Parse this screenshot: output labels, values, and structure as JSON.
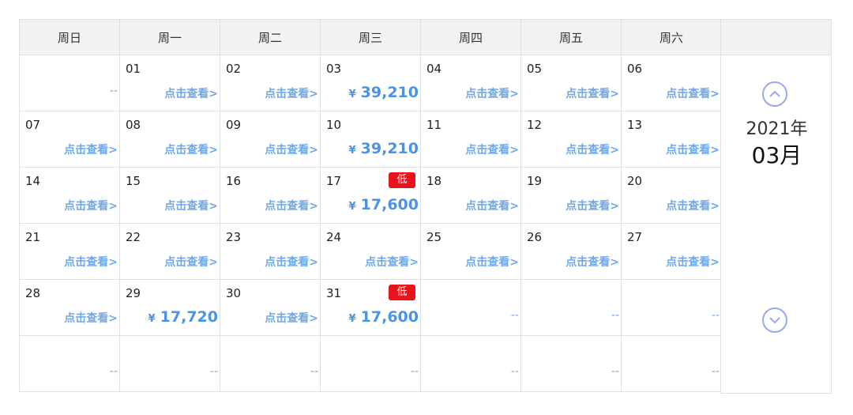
{
  "weekdays": [
    "周日",
    "周一",
    "周二",
    "周三",
    "周四",
    "周五",
    "周六"
  ],
  "view_link": "点击查看>",
  "low_badge": "低",
  "currency": "¥",
  "empty_mark": "--",
  "colors": {
    "accent": "#4a94e8",
    "badge": "#e8131b",
    "arrow": "#9aa6f0"
  },
  "navigator": {
    "year": "2021年",
    "month": "03月",
    "prev_icon": "chevron-up-icon",
    "next_icon": "chevron-down-icon"
  },
  "weeks": [
    [
      {
        "day": "",
        "type": "empty"
      },
      {
        "day": "01",
        "type": "link"
      },
      {
        "day": "02",
        "type": "link"
      },
      {
        "day": "03",
        "type": "price",
        "price": "39,210"
      },
      {
        "day": "04",
        "type": "link"
      },
      {
        "day": "05",
        "type": "link"
      },
      {
        "day": "06",
        "type": "link"
      }
    ],
    [
      {
        "day": "07",
        "type": "link"
      },
      {
        "day": "08",
        "type": "link"
      },
      {
        "day": "09",
        "type": "link"
      },
      {
        "day": "10",
        "type": "price",
        "price": "39,210"
      },
      {
        "day": "11",
        "type": "link"
      },
      {
        "day": "12",
        "type": "link"
      },
      {
        "day": "13",
        "type": "link"
      }
    ],
    [
      {
        "day": "14",
        "type": "link"
      },
      {
        "day": "15",
        "type": "link"
      },
      {
        "day": "16",
        "type": "link"
      },
      {
        "day": "17",
        "type": "price",
        "price": "17,600",
        "low": true
      },
      {
        "day": "18",
        "type": "link"
      },
      {
        "day": "19",
        "type": "link"
      },
      {
        "day": "20",
        "type": "link"
      }
    ],
    [
      {
        "day": "21",
        "type": "link"
      },
      {
        "day": "22",
        "type": "link"
      },
      {
        "day": "23",
        "type": "link"
      },
      {
        "day": "24",
        "type": "link"
      },
      {
        "day": "25",
        "type": "link"
      },
      {
        "day": "26",
        "type": "link"
      },
      {
        "day": "27",
        "type": "link"
      }
    ],
    [
      {
        "day": "28",
        "type": "link"
      },
      {
        "day": "29",
        "type": "price",
        "price": "17,720"
      },
      {
        "day": "30",
        "type": "link"
      },
      {
        "day": "31",
        "type": "price",
        "price": "17,600",
        "low": true
      },
      {
        "day": "",
        "type": "empty"
      },
      {
        "day": "",
        "type": "empty"
      },
      {
        "day": "",
        "type": "empty"
      }
    ],
    [
      {
        "day": "",
        "type": "empty"
      },
      {
        "day": "",
        "type": "empty"
      },
      {
        "day": "",
        "type": "empty"
      },
      {
        "day": "",
        "type": "empty"
      },
      {
        "day": "",
        "type": "empty"
      },
      {
        "day": "",
        "type": "empty"
      },
      {
        "day": "",
        "type": "empty"
      }
    ]
  ]
}
